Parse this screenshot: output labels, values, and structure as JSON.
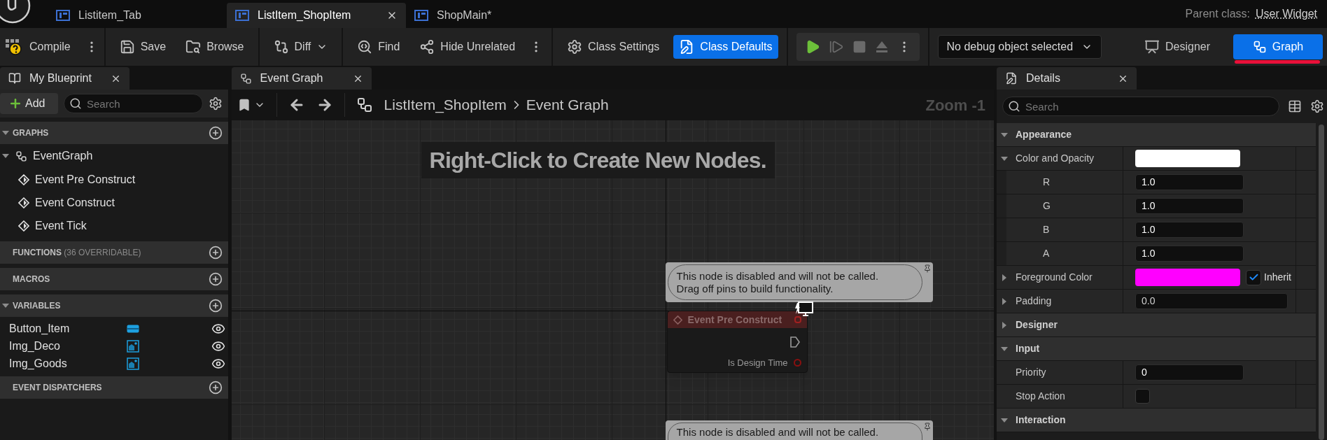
{
  "editor_tabs": [
    {
      "label": "Listitem_Tab",
      "selected": false
    },
    {
      "label": "ListItem_ShopItem",
      "selected": true
    },
    {
      "label": "ShopMain*",
      "selected": false
    }
  ],
  "parent_class": {
    "label": "Parent class:",
    "value": "User Widget"
  },
  "toolbar": {
    "groups": [
      [
        {
          "label": "Compile",
          "more_menu": true
        }
      ],
      [
        {
          "label": "Save"
        },
        {
          "label": "Browse"
        }
      ],
      [
        {
          "label": "Diff",
          "dropdown": true
        }
      ],
      [
        {
          "label": "Find"
        },
        {
          "label": "Hide Unrelated",
          "more_menu": true
        }
      ],
      [
        {
          "label": "Class Settings"
        },
        {
          "label": "Class Defaults",
          "primary": true
        }
      ]
    ],
    "debug_dropdown": "No debug object selected",
    "modes": [
      {
        "label": "Designer",
        "selected": false
      },
      {
        "label": "Graph",
        "selected": true
      }
    ]
  },
  "my_blueprint": {
    "tab": "My Blueprint",
    "add_label": "Add",
    "search_placeholder": "Search",
    "sections": [
      {
        "title": "GRAPHS",
        "expanded": true,
        "graphs": [
          {
            "label": "EventGraph",
            "expanded": true,
            "children": [
              {
                "label": "Event Pre Construct"
              },
              {
                "label": "Event Construct"
              },
              {
                "label": "Event Tick"
              }
            ]
          }
        ]
      },
      {
        "title": "FUNCTIONS",
        "note": "(36 OVERRIDABLE)"
      },
      {
        "title": "MACROS"
      },
      {
        "title": "VARIABLES",
        "expanded": true,
        "variables": [
          {
            "name": "Button_Item",
            "kind": "button"
          },
          {
            "name": "Img_Deco",
            "kind": "image"
          },
          {
            "name": "Img_Goods",
            "kind": "image"
          }
        ]
      },
      {
        "title": "EVENT DISPATCHERS"
      }
    ]
  },
  "graph": {
    "tab": "Event Graph",
    "breadcrumb": [
      "ListItem_ShopItem",
      "Event Graph"
    ],
    "zoom": "Zoom -1",
    "hint": "Right-Click to Create New Nodes.",
    "nodes": [
      {
        "comment_lines": [
          "This node is disabled and will not be called.",
          "Drag off pins to build functionality."
        ],
        "title": "Event Pre Construct",
        "pin_label": "Is Design Time"
      },
      {
        "comment_lines": [
          "This node is disabled and will not be called."
        ]
      }
    ]
  },
  "details": {
    "tab": "Details",
    "search_placeholder": "Search",
    "sections": [
      {
        "title": "Appearance",
        "expanded": true,
        "properties": [
          {
            "kind": "color",
            "label": "Color and Opacity",
            "expanded": true,
            "color": "#ffffff",
            "children": [
              {
                "kind": "number",
                "label": "R",
                "value": "1.0"
              },
              {
                "kind": "number",
                "label": "G",
                "value": "1.0"
              },
              {
                "kind": "number",
                "label": "B",
                "value": "1.0"
              },
              {
                "kind": "number",
                "label": "A",
                "value": "1.0"
              }
            ]
          },
          {
            "kind": "color",
            "label": "Foreground Color",
            "expanded": false,
            "color": "#ff00ff",
            "inherit": {
              "label": "Inherit",
              "checked": true
            }
          },
          {
            "kind": "struct",
            "label": "Padding",
            "expanded": false,
            "value": "0.0"
          }
        ]
      },
      {
        "title": "Designer",
        "expanded": false
      },
      {
        "title": "Input",
        "expanded": true,
        "properties": [
          {
            "kind": "number",
            "label": "Priority",
            "value": "0"
          },
          {
            "kind": "checkbox",
            "label": "Stop Action",
            "checked": false
          }
        ]
      },
      {
        "title": "Interaction",
        "expanded": true
      }
    ]
  }
}
